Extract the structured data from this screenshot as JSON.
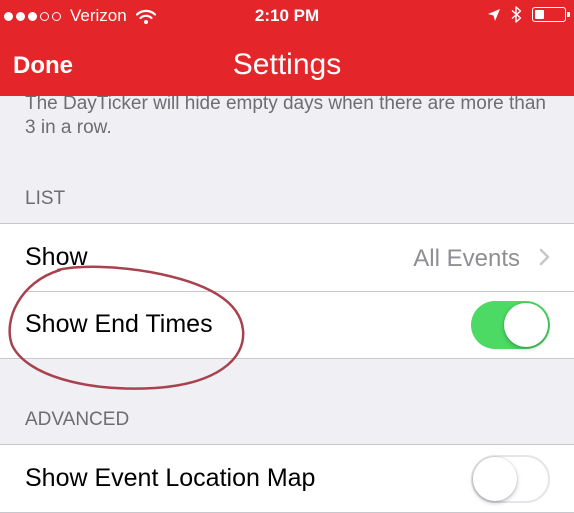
{
  "status_bar": {
    "carrier": "Verizon",
    "time": "2:10 PM",
    "signal_bars_filled": 3,
    "signal_bars_total": 5,
    "battery_level": 0.25
  },
  "nav": {
    "done_label": "Done",
    "title": "Settings"
  },
  "footnote": "The DayTicker will hide empty days when there are more than 3 in a row.",
  "list_section": {
    "header": "LIST",
    "show_row": {
      "label": "Show",
      "value": "All Events"
    },
    "end_times_row": {
      "label": "Show End Times",
      "toggle_on": true
    }
  },
  "advanced_section": {
    "header": "ADVANCED",
    "location_map_row": {
      "label": "Show Event Location Map",
      "toggle_on": false
    }
  },
  "colors": {
    "nav_red": "#e4262b",
    "toggle_green": "#4cd964",
    "annotation_ink": "#a8424e"
  }
}
